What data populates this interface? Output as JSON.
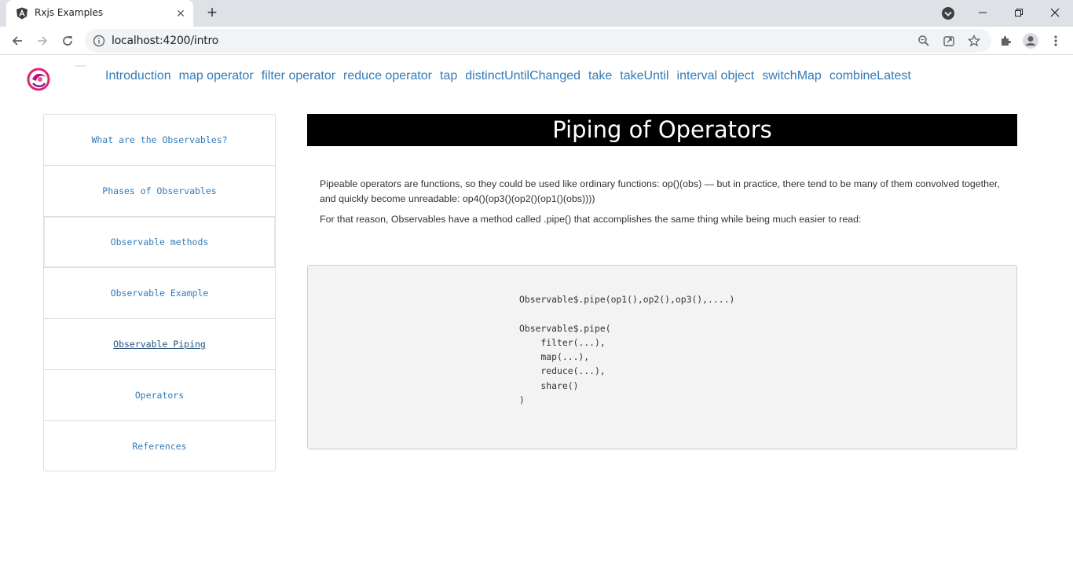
{
  "browser": {
    "tab_title": "Rxjs Examples",
    "url": "localhost:4200/intro",
    "new_tab_symbol": "+",
    "close_tab_symbol": "✕"
  },
  "topnav": [
    "Introduction",
    "map operator",
    "filter operator",
    "reduce operator",
    "tap",
    "distinctUntilChanged",
    "take",
    "takeUntil",
    "interval object",
    "switchMap",
    "combineLatest"
  ],
  "sidebar": {
    "items": [
      "What are the Observables?",
      "Phases of Observables",
      "Observable methods",
      "Observable Example",
      "Observable Piping",
      "Operators",
      "References"
    ],
    "current": "Observable Piping"
  },
  "main": {
    "title": "Piping of Operators",
    "paragraph1": "Pipeable operators are functions, so they could be used like ordinary functions: op()(obs) — but in practice, there tend to be many of them convolved together, and quickly become unreadable: op4()(op3()(op2()(op1()(obs))))",
    "paragraph2": "For that reason, Observables have a method called .pipe() that accomplishes the same thing while being much easier to read:",
    "code": "Observable$.pipe(op1(),op2(),op3(),....)\n\nObservable$.pipe(\n    filter(...),\n    map(...),\n    reduce(...),\n    share()\n)"
  },
  "colors": {
    "link": "#337ab7",
    "banner_bg": "#000000",
    "code_bg": "#f3f3f3",
    "logo_accent": "#e0246f"
  }
}
